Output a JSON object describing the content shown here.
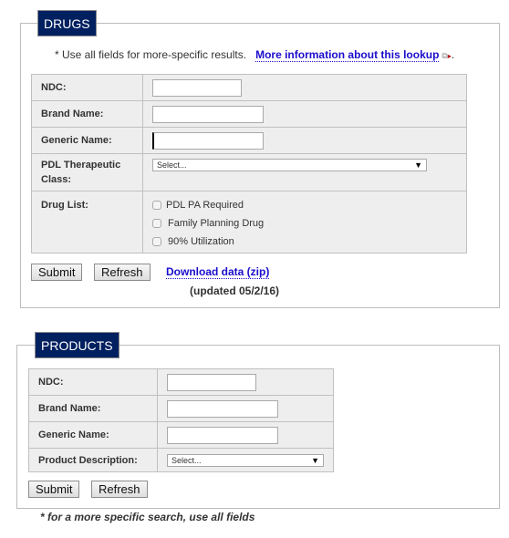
{
  "drugs": {
    "legend": "DRUGS",
    "note": "* Use all fields for more-specific results.",
    "more_info_link": "More information about this lookup",
    "fields": {
      "ndc_label": "NDC:",
      "ndc_value": "",
      "brand_label": "Brand Name:",
      "brand_value": "",
      "generic_label": "Generic Name:",
      "generic_value": "",
      "pdl_label": "PDL Therapeutic Class:",
      "pdl_selected": "Select...",
      "druglist_label": "Drug List:"
    },
    "checkboxes": [
      {
        "label": "PDL PA Required",
        "checked": false
      },
      {
        "label": "Family Planning Drug",
        "checked": false
      },
      {
        "label": "90% Utilization",
        "checked": false
      }
    ],
    "submit_label": "Submit",
    "refresh_label": "Refresh",
    "download_link": "Download data (zip)",
    "updated": "(updated 05/2/16)"
  },
  "products": {
    "legend": "PRODUCTS",
    "fields": {
      "ndc_label": "NDC:",
      "ndc_value": "",
      "brand_label": "Brand Name:",
      "brand_value": "",
      "generic_label": "Generic Name:",
      "generic_value": "",
      "desc_label": "Product Description:",
      "desc_selected": "Select..."
    },
    "submit_label": "Submit",
    "refresh_label": "Refresh",
    "footnote": "* for a more specific search, use all fields"
  },
  "icons": {
    "external_link": "external-window-icon",
    "dropdown": "triangle-down"
  }
}
